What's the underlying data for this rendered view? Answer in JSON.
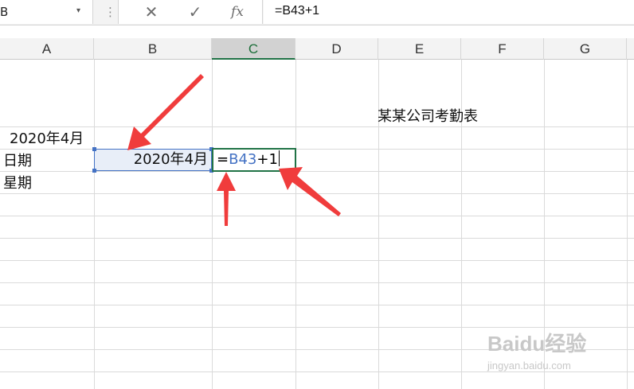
{
  "formula_bar": {
    "name_box_value": "B",
    "name_box_arrow": "▾",
    "dots": "⋮",
    "cancel_icon": "✕",
    "enter_icon": "✓",
    "fx_label": "fx",
    "formula_text": "=B43+1"
  },
  "columns": [
    "A",
    "B",
    "C",
    "D",
    "E",
    "F",
    "G"
  ],
  "active_column": "C",
  "cells": {
    "e_title": "某某公司考勤表",
    "a_month": "2020年4月",
    "a_date_label": "日期",
    "a_week_label": "星期",
    "b_value": "2020年4月"
  },
  "editing_cell": {
    "prefix": "=",
    "ref": "B43",
    "suffix": "+1"
  },
  "annotation_colors": {
    "arrow": "#f03c3c",
    "selection_border": "#4472c4",
    "edit_border": "#217346"
  },
  "watermark": {
    "logo": "Baidu经验",
    "url": "jingyan.baidu.com"
  }
}
